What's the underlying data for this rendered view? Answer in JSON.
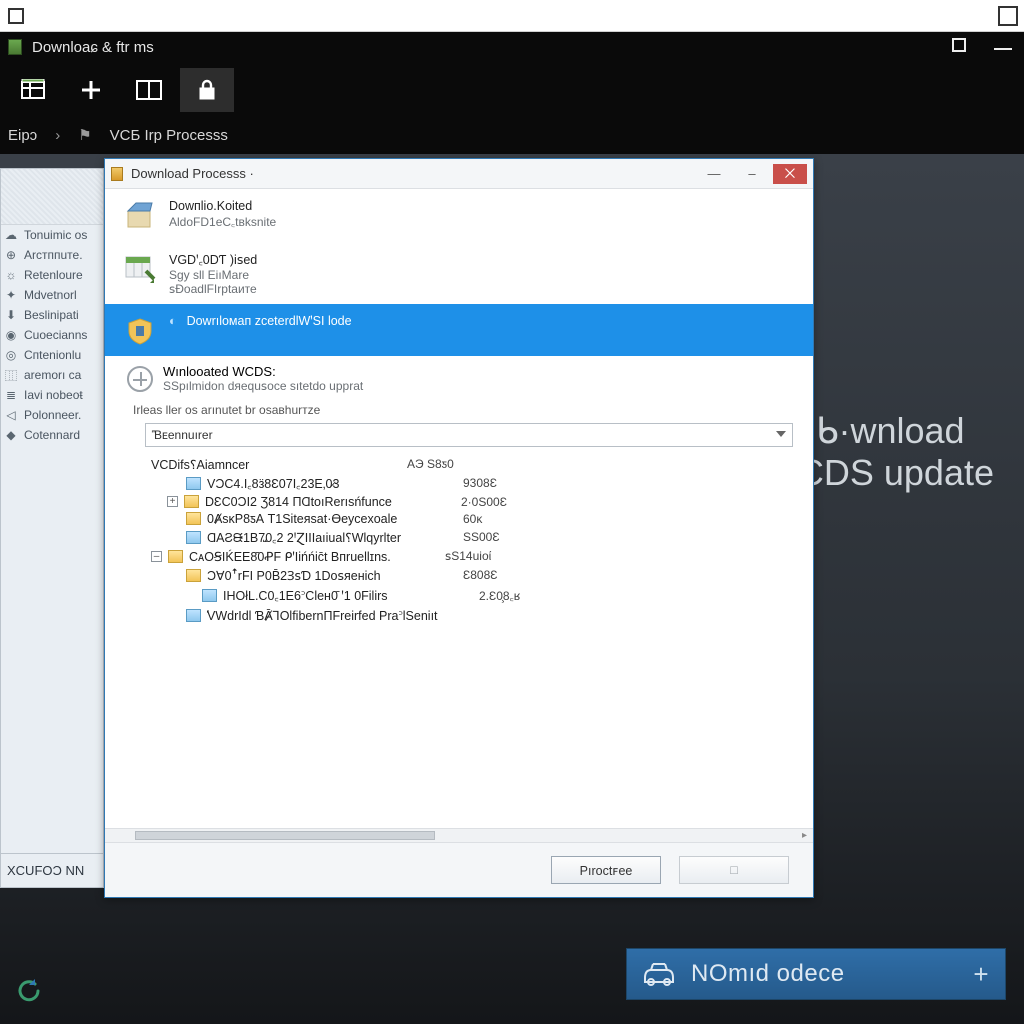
{
  "outer_chrome": {
    "left": "",
    "right": ""
  },
  "ribbon": {
    "title": "Downloaɕ & ftr ms",
    "crumb_left": "Eipɔ",
    "crumb_right": "VCБ Irp Processs"
  },
  "sidebar": {
    "items": [
      "Tonuimic os",
      "Arᴄтппuте.",
      "Retenloure",
      "Mdvetnorl",
      "Beslinipati",
      "Cuoecianns",
      "Cпtenionlu",
      "aremorı ca",
      "Iavi nobeoŧ",
      "Polonneer.",
      "Cotennard"
    ],
    "footer": "XCUFOƆ NN"
  },
  "bigtext": {
    "line1": "ᑲ·wnload",
    "line2": "VCDS update"
  },
  "pill": {
    "label": "NOmıd odece"
  },
  "dialog": {
    "title": "Download Processs ·",
    "steps": [
      {
        "b": "Dowпlio.Koited",
        "s": "AldoFD1eC꜀tвksnite"
      },
      {
        "b": "VGDꞌ꜀0DƬ )iꜱed",
        "s1": "Sgy sll EiıMare",
        "s2": "ꜱĐoadlFIrptaите"
      },
      {
        "b": "Dowrıloмaп zceterdlWꞌSI lode",
        "s": ""
      },
      {
        "b": "Wınlooated WCDS:",
        "s": "SSpılmidon dяequꜱoce sıtetdo upprat"
      }
    ],
    "prompt": "Irleas ller os arınutet br osaвhurᴛze",
    "combo_value": "꜠Bᴇеnnuırer",
    "tree_header": {
      "name": "VCDifs⸮Aiamncer",
      "size": "AЭ S8ƽ0"
    },
    "rows": [
      {
        "name": "VƆC4.І꜀8ӟ8Ɛ07I꜀23E‚0̷3",
        "size": "9308Ɛ",
        "type": "file",
        "indent": 1
      },
      {
        "name": "DƐC0ƆI2 Ʒ814 ПⱭtoıRerısńfunce",
        "size": "2·0S00Ɛ",
        "type": "folder",
        "expand": "+",
        "indent": 1
      },
      {
        "name": "0ȺsᴋP8ƽА Т1Ѕiteяsat·Ɵeyᴄexoale",
        "size": "60ᴋ",
        "type": "folder",
        "indent": 1
      },
      {
        "name": "ⱭAƧᙠ1B7꜡0꜀2 2ꞋⱿIIIaıiual⸮Wlqyrlter",
        "size": "SS00Ɛ",
        "type": "file",
        "indent": 1
      },
      {
        "name": "СᴀOꞨIḰEE8̄0ꝒF ᑭꞌIińńic̄t Bпruellɪns.",
        "size": "ꜱS14uioί",
        "type": "folder",
        "expand": "–",
        "indent": 0
      },
      {
        "name": "ƆⱯ0ꜛrFI P0B̄2ꞫꜱƊ 1Doꜱяeнiсh",
        "size": "Ɛ808Ɛ",
        "type": "folder",
        "indent": 1
      },
      {
        "name": "IHOłL.C0꜀1E6꜄Cleн0̄ ꞌ1 0Filirs",
        "size": "2.Ɛ0̧8꜀ʁ",
        "type": "file",
        "indent": 2
      },
      {
        "name": "꜠VWdrIdl ƁȺ̄ꞀOlfibernПFreirfed Pra꜄lSeniıt",
        "size": "",
        "type": "file",
        "indent": 1
      }
    ],
    "proceed": "Pıroсtꜰee",
    "secondary": "□"
  }
}
